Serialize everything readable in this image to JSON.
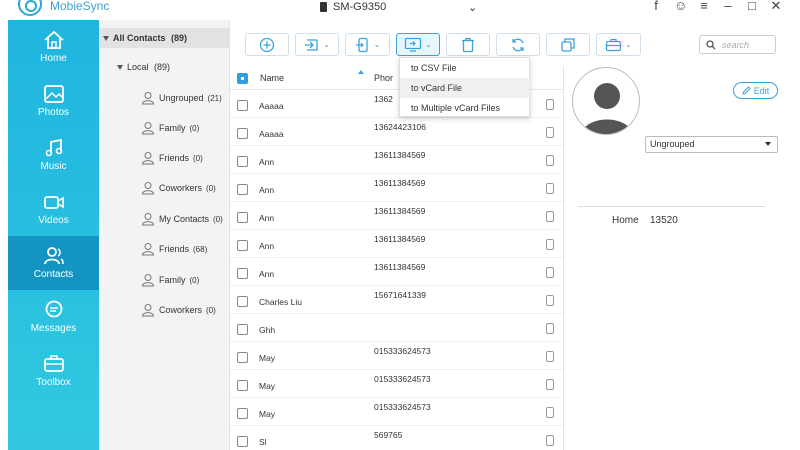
{
  "app": {
    "name": "MobieSync",
    "device": "SM-G9350"
  },
  "colors": {
    "nav_bg": "#1fb5df",
    "nav_active": "#1394c3",
    "accent": "#3aa3d8"
  },
  "nav": [
    {
      "label": "Home",
      "icon": "home-icon"
    },
    {
      "label": "Photos",
      "icon": "photos-icon"
    },
    {
      "label": "Music",
      "icon": "music-icon"
    },
    {
      "label": "Videos",
      "icon": "videos-icon"
    },
    {
      "label": "Contacts",
      "icon": "contacts-icon",
      "active": true
    },
    {
      "label": "Messages",
      "icon": "messages-icon"
    },
    {
      "label": "Toolbox",
      "icon": "toolbox-icon"
    }
  ],
  "groups": {
    "all_label": "All Contacts",
    "all_count": "(89)",
    "local_label": "Local",
    "local_count": "(89)",
    "items": [
      {
        "label": "Ungrouped",
        "count": "(21)"
      },
      {
        "label": "Family",
        "count": "(0)"
      },
      {
        "label": "Friends",
        "count": "(0)"
      },
      {
        "label": "Coworkers",
        "count": "(0)"
      },
      {
        "label": "My Contacts",
        "count": "(0)"
      },
      {
        "label": "Friends",
        "count": "(68)"
      },
      {
        "label": "Family",
        "count": "(0)"
      },
      {
        "label": "Coworkers",
        "count": "(0)"
      }
    ]
  },
  "toolbar": {
    "search_placeholder": "search",
    "buttons": [
      "add-icon",
      "import-icon",
      "transfer-to-device-icon",
      "export-to-pc-icon",
      "trash-icon",
      "refresh-icon",
      "deduplicate-icon",
      "toolbox-icon"
    ]
  },
  "export_menu": [
    "to CSV File",
    "to vCard File",
    "to Multiple vCard Files"
  ],
  "list": {
    "col_name": "Name",
    "col_phone": "Phor",
    "rows": [
      {
        "name": "Aaaaa",
        "phone": "1362"
      },
      {
        "name": "Aaaaa",
        "phone": "13624423106"
      },
      {
        "name": "Ann",
        "phone": "13611384569"
      },
      {
        "name": "Ann",
        "phone": "13611384569"
      },
      {
        "name": "Ann",
        "phone": "13611384569"
      },
      {
        "name": "Ann",
        "phone": "13611384569"
      },
      {
        "name": "Ann",
        "phone": "13611384569"
      },
      {
        "name": "Charles Liu",
        "phone": "15671641339"
      },
      {
        "name": "Ghh",
        "phone": ""
      },
      {
        "name": "May",
        "phone": "015333624573"
      },
      {
        "name": "May",
        "phone": "015333624573"
      },
      {
        "name": "May",
        "phone": "015333624573"
      },
      {
        "name": "Sl",
        "phone": "569765"
      }
    ]
  },
  "detail": {
    "edit_label": "Edit",
    "group_value": "Ungrouped",
    "field_label": "Home",
    "field_value": "13520"
  }
}
